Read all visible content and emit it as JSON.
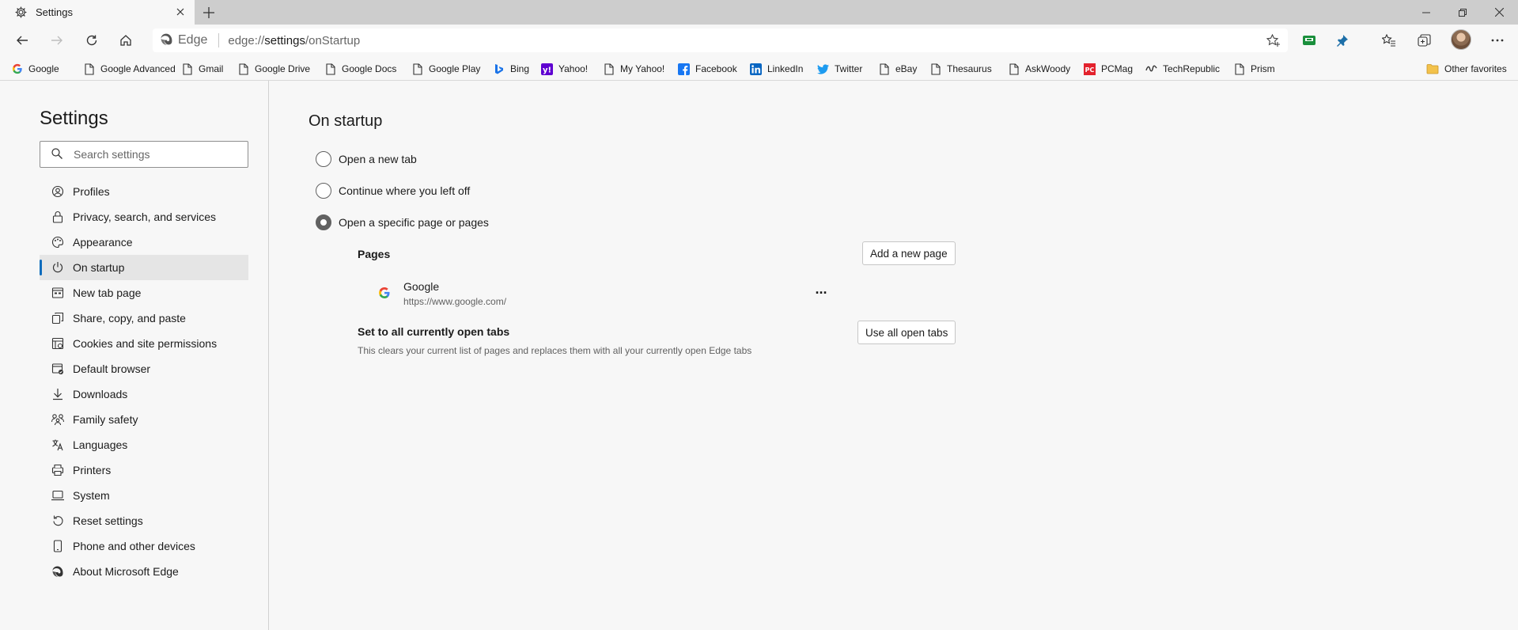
{
  "tab": {
    "title": "Settings"
  },
  "omnibox": {
    "edge_label": "Edge",
    "url_prefix": "edge://",
    "url_strong": "settings",
    "url_suffix": "/onStartup"
  },
  "favorites": [
    {
      "label": "Google",
      "icon": "google-g-icon"
    },
    {
      "label": "Google Advanced",
      "icon": "page-icon"
    },
    {
      "label": "Gmail",
      "icon": "page-icon"
    },
    {
      "label": "Google Drive",
      "icon": "page-icon"
    },
    {
      "label": "Google Docs",
      "icon": "page-icon"
    },
    {
      "label": "Google Play",
      "icon": "page-icon"
    },
    {
      "label": "Bing",
      "icon": "bing-icon"
    },
    {
      "label": "Yahoo!",
      "icon": "yahoo-icon"
    },
    {
      "label": "My Yahoo!",
      "icon": "page-icon"
    },
    {
      "label": "Facebook",
      "icon": "facebook-icon"
    },
    {
      "label": "LinkedIn",
      "icon": "linkedin-icon"
    },
    {
      "label": "Twitter",
      "icon": "twitter-icon"
    },
    {
      "label": "eBay",
      "icon": "page-icon"
    },
    {
      "label": "Thesaurus",
      "icon": "page-icon"
    },
    {
      "label": "AskWoody",
      "icon": "page-icon"
    },
    {
      "label": "PCMag",
      "icon": "pcmag-icon"
    },
    {
      "label": "TechRepublic",
      "icon": "techrepublic-icon"
    },
    {
      "label": "Prism",
      "icon": "page-icon"
    }
  ],
  "other_favorites": "Other favorites",
  "sidebar": {
    "title": "Settings",
    "search_placeholder": "Search settings",
    "items": [
      {
        "label": "Profiles",
        "icon": "profile-icon"
      },
      {
        "label": "Privacy, search, and services",
        "icon": "lock-icon"
      },
      {
        "label": "Appearance",
        "icon": "appearance-icon"
      },
      {
        "label": "On startup",
        "icon": "power-icon",
        "active": true
      },
      {
        "label": "New tab page",
        "icon": "new-tab-page-icon"
      },
      {
        "label": "Share, copy, and paste",
        "icon": "share-icon"
      },
      {
        "label": "Cookies and site permissions",
        "icon": "cookies-icon"
      },
      {
        "label": "Default browser",
        "icon": "default-browser-icon"
      },
      {
        "label": "Downloads",
        "icon": "download-icon"
      },
      {
        "label": "Family safety",
        "icon": "family-icon"
      },
      {
        "label": "Languages",
        "icon": "languages-icon"
      },
      {
        "label": "Printers",
        "icon": "printer-icon"
      },
      {
        "label": "System",
        "icon": "laptop-icon"
      },
      {
        "label": "Reset settings",
        "icon": "reset-icon"
      },
      {
        "label": "Phone and other devices",
        "icon": "phone-icon"
      },
      {
        "label": "About Microsoft Edge",
        "icon": "edge-logo-icon"
      }
    ]
  },
  "main": {
    "title": "On startup",
    "options": [
      {
        "label": "Open a new tab",
        "selected": false
      },
      {
        "label": "Continue where you left off",
        "selected": false
      },
      {
        "label": "Open a specific page or pages",
        "selected": true
      }
    ],
    "pages_label": "Pages",
    "add_page_button": "Add a new page",
    "page_entry": {
      "name": "Google",
      "url": "https://www.google.com/"
    },
    "more_label": "···",
    "set_all_label": "Set to all currently open tabs",
    "set_all_description": "This clears your current list of pages and replaces them with all your currently open Edge tabs",
    "use_all_tabs_button": "Use all open tabs"
  },
  "colors": {
    "accent": "#0f6cbd",
    "sidebar_active": "#e5e5e5",
    "page_bg": "#f7f7f7"
  }
}
